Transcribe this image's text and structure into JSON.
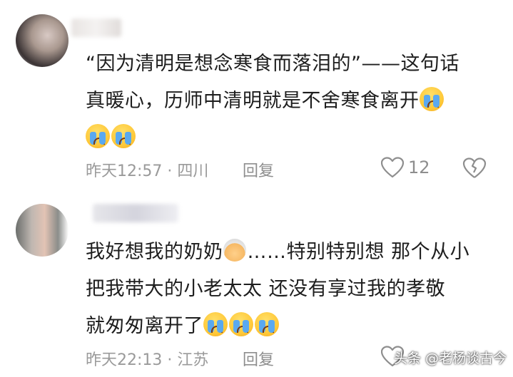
{
  "comments": [
    {
      "text_line1": "“因为清明是想念寒食而落泪的”——这句话",
      "text_line2": "真暖心，历师中清明就是不舍寒食离开",
      "time": "昨天12:57",
      "location": "四川",
      "reply_label": "回复",
      "likes": "12"
    },
    {
      "text_line1": "我好想我的奶奶",
      "text_line1b": "……特别特别想 那个从小",
      "text_line2": "把我带大的小老太太 还没有享过我的孝敬",
      "text_line3": "就匆匆离开了",
      "time": "昨天22:13",
      "location": "江苏",
      "reply_label": "回复"
    }
  ],
  "meta_separator": "·",
  "watermark": "头条 @老杨谈古今",
  "colors": {
    "meta_gray": "#9a9a9a",
    "text": "#1e1e1e"
  }
}
